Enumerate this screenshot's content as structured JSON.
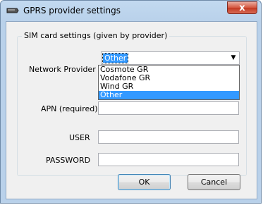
{
  "window": {
    "title": "GPRS provider settings",
    "close_label": "x"
  },
  "group": {
    "title": "SIM card settings (given by provider)"
  },
  "form": {
    "network_provider_label": "Network Provider",
    "network_provider_value": "Other",
    "options": [
      "Cosmote GR",
      "Vodafone GR",
      "Wind GR",
      "Other"
    ],
    "selected_option": "Other",
    "apn_label": "APN (required)",
    "apn_value": "",
    "user_label": "USER",
    "user_value": "",
    "password_label": "PASSWORD",
    "password_value": ""
  },
  "buttons": {
    "ok": "OK",
    "cancel": "Cancel"
  },
  "icons": {
    "app": "device-icon",
    "dropdown": "chevron-down-icon"
  },
  "colors": {
    "selection": "#3399ff",
    "dialog_bg": "#f0f0f0",
    "close_button": "#c23a22"
  }
}
